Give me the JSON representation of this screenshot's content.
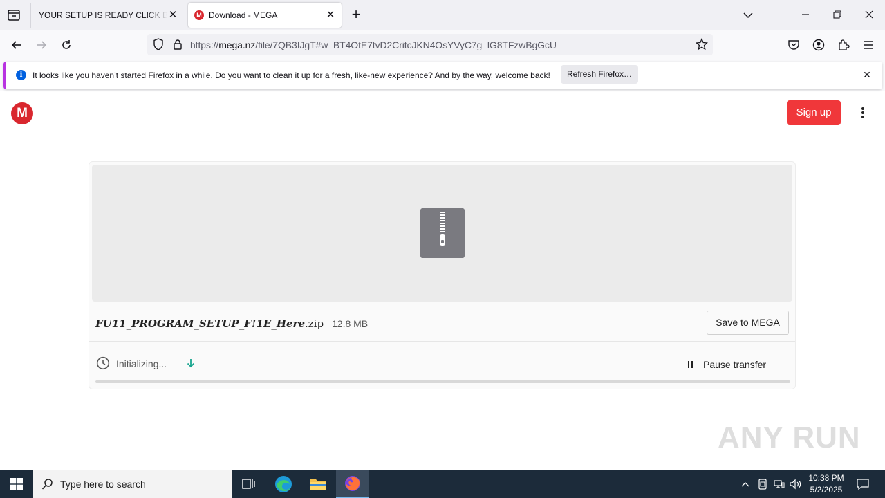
{
  "browser": {
    "tabs": [
      {
        "title": "YOUR SETUP IS READY CLICK BELOW",
        "active": false
      },
      {
        "title": "Download - MEGA",
        "active": true
      }
    ],
    "url_prefix": "https://",
    "url_host": "mega.nz",
    "url_path": "/file/7QB3IJgT#w_BT4OtE7tvD2CritcJKN4OsYVyC7g_lG8TFzwBgGcU"
  },
  "notification": {
    "text": "It looks like you haven’t started Firefox in a while. Do you want to clean it up for a fresh, like-new experience? And by the way, welcome back!",
    "button_label": "Refresh Firefox…"
  },
  "page": {
    "logo_letter": "M",
    "signup_label": "Sign up",
    "file": {
      "name_styled": "FU11_PROGRAM_SETUP_F!1E_Here",
      "extension": ".zip",
      "size": "12.8 MB",
      "save_label": "Save to MEGA"
    },
    "transfer": {
      "status": "Initializing...",
      "pause_label": "Pause transfer",
      "progress": 0
    },
    "watermark": "ANY RUN"
  },
  "taskbar": {
    "search_placeholder": "Type here to search",
    "time": "10:38 PM",
    "date": "5/2/2025"
  },
  "colors": {
    "mega_red": "#d9272e",
    "signup_red": "#f0373a",
    "firefox_blue": "#0060df",
    "taskbar": "#1c2b3a"
  },
  "icons": [
    "tab-list-icon",
    "close-icon",
    "plus-icon",
    "chevron-down-icon",
    "minimize-icon",
    "restore-icon",
    "back-icon",
    "forward-icon",
    "reload-icon",
    "shield-icon",
    "lock-icon",
    "star-icon",
    "pocket-icon",
    "account-icon",
    "extensions-icon",
    "menu-icon",
    "info-icon",
    "zip-file-icon",
    "clock-icon",
    "arrow-down-icon",
    "pause-icon",
    "windows-start-icon",
    "search-icon",
    "task-view-icon",
    "edge-icon",
    "file-explorer-icon",
    "firefox-icon"
  ]
}
